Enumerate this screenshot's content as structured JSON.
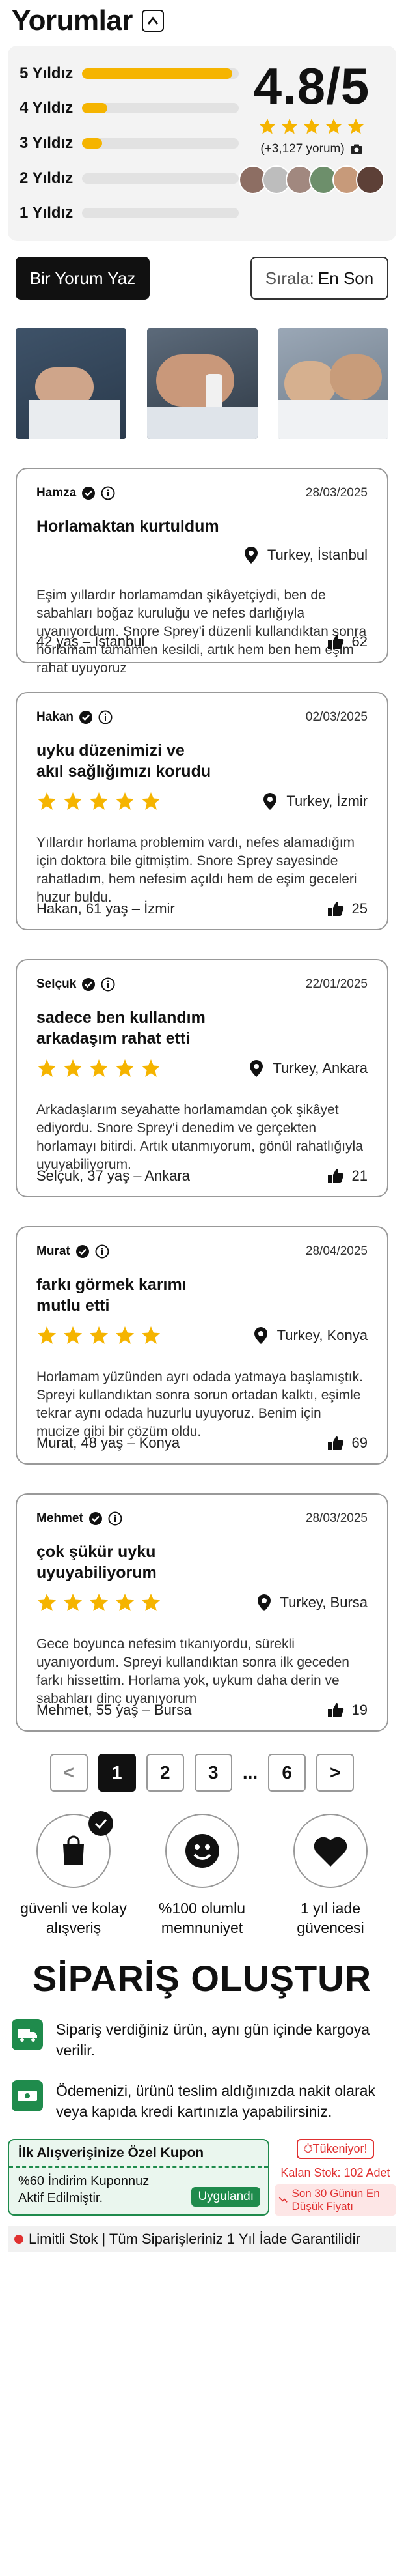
{
  "header": {
    "title": "Yorumlar"
  },
  "summary": {
    "distribution": [
      {
        "label": "5 Yıldız",
        "fraction": 0.96
      },
      {
        "label": "4 Yıldız",
        "fraction": 0.16
      },
      {
        "label": "3 Yıldız",
        "fraction": 0.13
      },
      {
        "label": "2 Yıldız",
        "fraction": 0.0
      },
      {
        "label": "1 Yıldız",
        "fraction": 0.0
      }
    ],
    "score": "4.8/5",
    "rating_count": "(+3,127 yorum)",
    "stars_filled": 5,
    "star_color": "#f5b400"
  },
  "actions": {
    "write_review": "Bir Yorum Yaz",
    "sort_label": "Sırala:",
    "sort_value": "En Son"
  },
  "reviews": [
    {
      "name": "Hamza",
      "date": "28/03/2025",
      "title": "Horlamaktan  kurtuldum",
      "stars": 0,
      "location": "Turkey, İstanbul",
      "body": "Eşim yıllardır horlamamdan şikâyetçiydi, ben de sabahları boğaz kuruluğu ve nefes darlığıyla uyanıyordum. Snore Sprey'i düzenli kullandıktan sonra horlamam tamamen kesildi, artık hem ben hem eşim rahat uyuyoruz",
      "footer": "42 yaş – İstanbul",
      "likes": "62"
    },
    {
      "name": "Hakan",
      "date": "02/03/2025",
      "title": "uyku düzenimizi ve akıl sağlığımızı korudu",
      "stars": 5,
      "location": "Turkey, İzmir",
      "body": "Yıllardır horlama problemim vardı, nefes alamadığım için doktora bile gitmiştim. Snore Sprey sayesinde rahatladım, hem nefesim açıldı hem de eşim geceleri huzur buldu.",
      "footer": "Hakan, 61 yaş – İzmir",
      "likes": "25"
    },
    {
      "name": "Selçuk",
      "date": "22/01/2025",
      "title": "sadece ben kullandım arkadaşım rahat etti",
      "stars": 5,
      "location": "Turkey, Ankara",
      "body": "Arkadaşlarım seyahatte horlamamdan çok şikâyet ediyordu. Snore Sprey'i denedim ve gerçekten horlamayı bitirdi. Artık utanmıyorum, gönül rahatlığıyla uyuyabiliyorum.",
      "footer": "Selçuk, 37 yaş – Ankara",
      "likes": "21"
    },
    {
      "name": "Murat",
      "date": "28/04/2025",
      "title": "farkı görmek karımı mutlu etti",
      "stars": 5,
      "location": "Turkey, Konya",
      "body": "Horlamam yüzünden ayrı odada yatmaya başlamıştık. Spreyi kullandıktan sonra sorun ortadan kalktı, eşimle tekrar aynı odada huzurlu uyuyoruz. Benim için mucize gibi bir çözüm oldu.",
      "footer": "Murat, 48 yaş – Konya",
      "likes": "69"
    },
    {
      "name": "Mehmet",
      "date": "28/03/2025",
      "title": "çok şükür uyku uyuyabiliyorum",
      "stars": 5,
      "location": "Turkey, Bursa",
      "body": "Gece boyunca nefesim tıkanıyordu, sürekli uyanıyordum. Spreyi kullandıktan sonra ilk geceden farkı hissettim. Horlama yok, uykum daha derin ve sabahları dinç uyanıyorum",
      "footer": "Mehmet, 55 yaş – Bursa",
      "likes": "19"
    }
  ],
  "pagination": {
    "prev": "<",
    "pages": [
      "1",
      "2",
      "3"
    ],
    "ellipsis": "...",
    "last": "6",
    "next": ">",
    "active": "1"
  },
  "badges": [
    {
      "icon": "shopping-bag-check-icon",
      "text": "güvenli ve kolay alışveriş"
    },
    {
      "icon": "smile-icon",
      "text": "%100 olumlu memnuniyet"
    },
    {
      "icon": "heart-icon",
      "text": "1 yıl iade güvencesi"
    }
  ],
  "order": {
    "title": "SİPARİŞ OLUŞTUR",
    "info1": "Sipariş verdiğiniz ürün, aynı gün içinde kargoya verilir.",
    "info2": "Ödemenizi, ürünü teslim aldığınızda nakit olarak veya kapıda kredi kartınızla yapabilirsiniz."
  },
  "coupon": {
    "title": "İlk Alışverişinize Özel Kupon",
    "body": "%60 İndirim Kuponnuz Aktif Edilmiştir.",
    "applied": "Uygulandı",
    "sold_out": "Tükeniyor!",
    "stock": "Kalan Stok: 102 Adet",
    "last_price": "Son 30 Günün En Düşük Fiyatı"
  },
  "ticker": "Limitli Stok | Tüm Siparişleriniz 1 Yıl İade Garantilidir",
  "colors": {
    "accent_green": "#1f8b4c",
    "alert_red": "#e03030",
    "star": "#f5b400"
  }
}
